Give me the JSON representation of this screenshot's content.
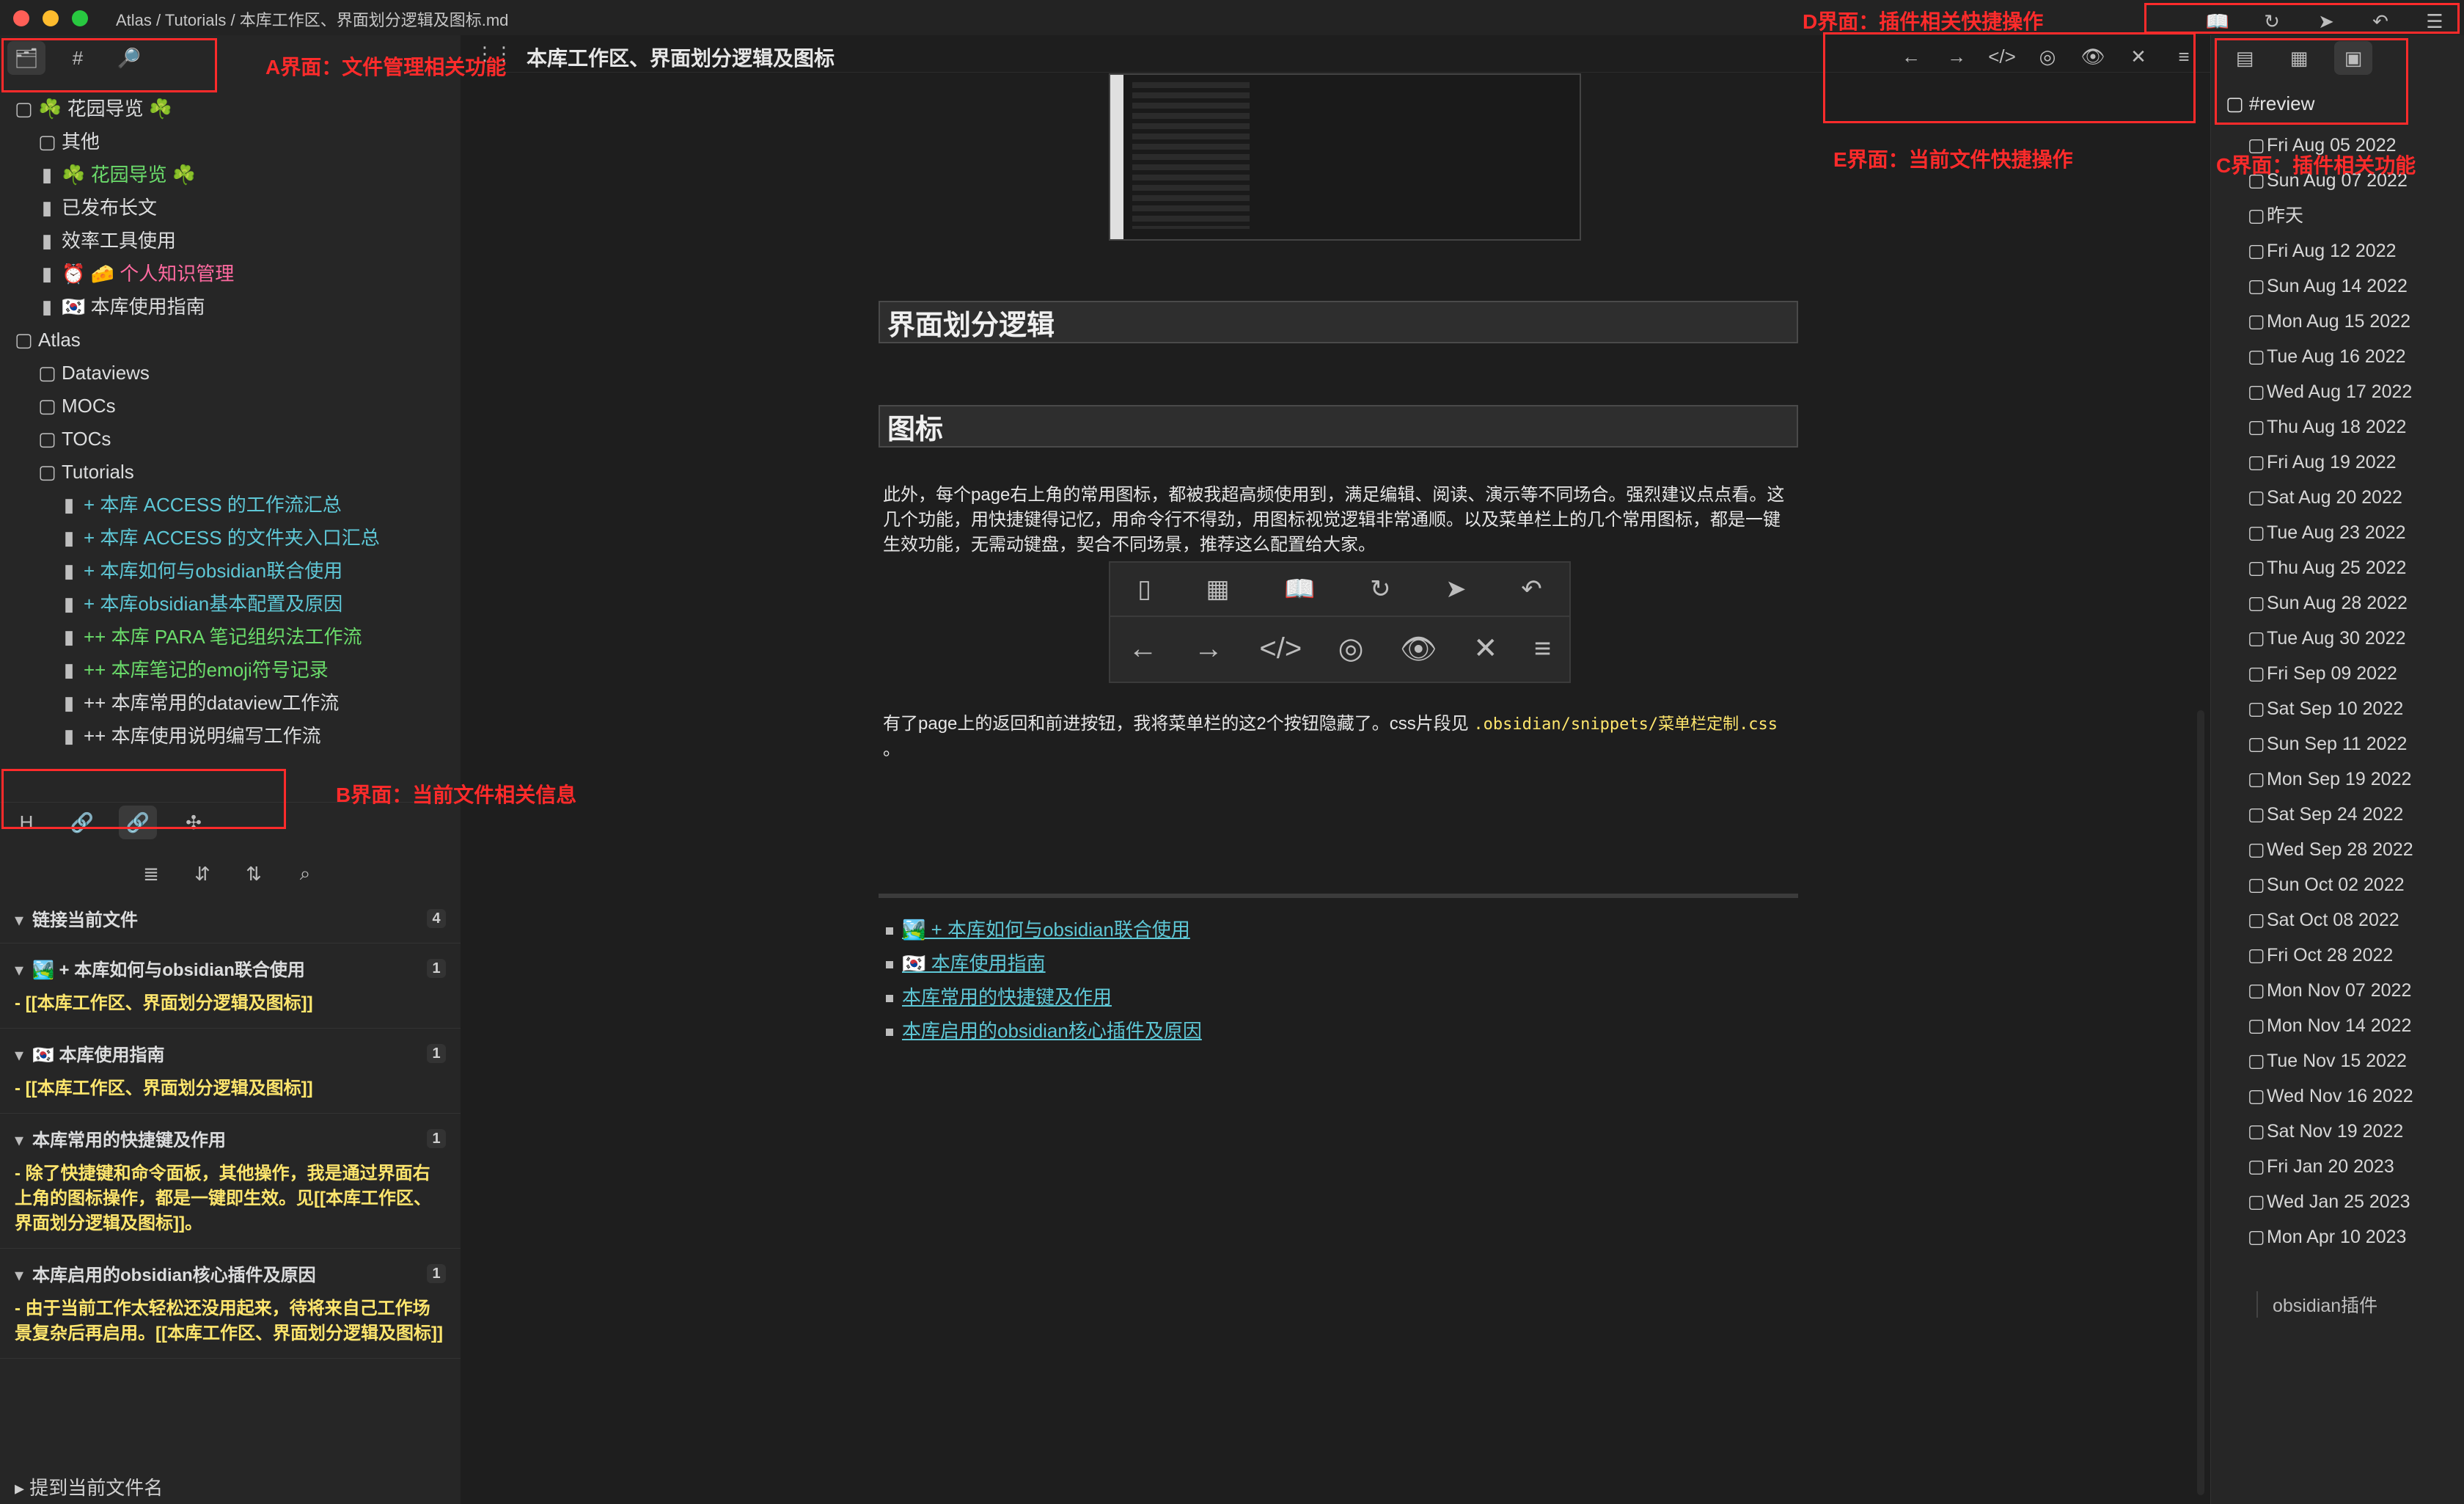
{
  "breadcrumb": "Atlas / Tutorials / 本库工作区、界面划分逻辑及图标.md",
  "annotations": {
    "A": "A界面：文件管理相关功能",
    "B": "B界面：当前文件相关信息",
    "C": "C界面：插件相关功能",
    "D": "D界面：插件相关快捷操作",
    "E": "E界面：当前文件快捷操作"
  },
  "left": {
    "tree": [
      {
        "level": 0,
        "icon": "folder-open-icon",
        "text": "☘️ 花园导览 ☘️"
      },
      {
        "level": 1,
        "icon": "folder-icon",
        "text": "其他"
      },
      {
        "level": 1,
        "icon": "doc-icon",
        "text": "☘️ 花园导览 ☘️",
        "cls": "green"
      },
      {
        "level": 1,
        "icon": "doc-icon",
        "text": "已发布长文"
      },
      {
        "level": 1,
        "icon": "doc-icon",
        "text": "效率工具使用"
      },
      {
        "level": 1,
        "icon": "doc-icon",
        "text": "⏰ 🧀 个人知识管理",
        "cls": "pink"
      },
      {
        "level": 1,
        "icon": "doc-icon",
        "text": "🇰🇷 本库使用指南"
      },
      {
        "level": 0,
        "icon": "folder-open-icon",
        "text": "Atlas"
      },
      {
        "level": 1,
        "icon": "folder-icon",
        "text": "Dataviews"
      },
      {
        "level": 1,
        "icon": "folder-icon",
        "text": "MOCs"
      },
      {
        "level": 1,
        "icon": "folder-icon",
        "text": "TOCs"
      },
      {
        "level": 1,
        "icon": "folder-open-icon",
        "text": "Tutorials"
      },
      {
        "level": 2,
        "icon": "doc-icon",
        "text": "+ 本库 ACCESS 的工作流汇总",
        "cls": "cyan"
      },
      {
        "level": 2,
        "icon": "doc-icon",
        "text": "+ 本库 ACCESS 的文件夹入口汇总",
        "cls": "cyan"
      },
      {
        "level": 2,
        "icon": "doc-icon",
        "text": "+ 本库如何与obsidian联合使用",
        "cls": "cyan"
      },
      {
        "level": 2,
        "icon": "doc-icon",
        "text": "+ 本库obsidian基本配置及原因",
        "cls": "cyan"
      },
      {
        "level": 2,
        "icon": "doc-icon",
        "text": "++ 本库 PARA 笔记组织法工作流",
        "cls": "green"
      },
      {
        "level": 2,
        "icon": "doc-icon",
        "text": "++ 本库笔记的emoji符号记录",
        "cls": "green"
      },
      {
        "level": 2,
        "icon": "doc-icon",
        "text": "++ 本库常用的dataview工作流"
      },
      {
        "level": 2,
        "icon": "doc-icon",
        "text": "++ 本库使用说明编写工作流"
      }
    ],
    "backlinks": {
      "sections": [
        {
          "title": "链接当前文件",
          "count": "4"
        },
        {
          "title": "🏞️ + 本库如何与obsidian联合使用",
          "count": "1",
          "snippet": "- [[本库工作区、界面划分逻辑及图标]]"
        },
        {
          "title": "🇰🇷 本库使用指南",
          "count": "1",
          "snippet": "- [[本库工作区、界面划分逻辑及图标]]"
        },
        {
          "title": "本库常用的快捷键及作用",
          "count": "1",
          "snippet": "- 除了快捷键和命令面板，其他操作，我是通过界面右上角的图标操作，都是一键即生效。见[[本库工作区、界面划分逻辑及图标]]。"
        },
        {
          "title": "本库启用的obsidian核心插件及原因",
          "count": "1",
          "snippet": "- 由于当前工作太轻松还没用起来，待将来自己工作场景复杂后再启用。[[本库工作区、界面划分逻辑及图标]]"
        }
      ],
      "bottom": "提到当前文件名"
    }
  },
  "main": {
    "title": "本库工作区、界面划分逻辑及图标",
    "h2a": "界面划分逻辑",
    "h2b": "图标",
    "para1": "此外，每个page右上角的常用图标，都被我超高频使用到，满足编辑、阅读、演示等不同场合。强烈建议点点看。这几个功能，用快捷键得记忆，用命令行不得劲，用图标视觉逻辑非常通顺。以及菜单栏上的几个常用图标，都是一键生效功能，无需动键盘，契合不同场景，推荐这么配置给大家。",
    "para2": "有了page上的返回和前进按钮，我将菜单栏的这2个按钮隐藏了。css片段见 ",
    "code": ".obsidian/snippets/菜单栏定制.css",
    "para2_end": "。",
    "links": [
      "🏞️ + 本库如何与obsidian联合使用",
      "🇰🇷 本库使用指南",
      "本库常用的快捷键及作用",
      "本库启用的obsidian核心插件及原因"
    ]
  },
  "right": {
    "title": "#review",
    "dates": [
      "Fri Aug 05 2022",
      "Sun Aug 07 2022",
      "昨天",
      "Fri Aug 12 2022",
      "Sun Aug 14 2022",
      "Mon Aug 15 2022",
      "Tue Aug 16 2022",
      "Wed Aug 17 2022",
      "Thu Aug 18 2022",
      "Fri Aug 19 2022",
      "Sat Aug 20 2022",
      "Tue Aug 23 2022",
      "Thu Aug 25 2022",
      "Sun Aug 28 2022",
      "Tue Aug 30 2022",
      "Fri Sep 09 2022",
      "Sat Sep 10 2022",
      "Sun Sep 11 2022",
      "Mon Sep 19 2022",
      "Sat Sep 24 2022",
      "Wed Sep 28 2022",
      "Sun Oct 02 2022",
      "Sat Oct 08 2022",
      "Fri Oct 28 2022",
      "Mon Nov 07 2022",
      "Mon Nov 14 2022",
      "Tue Nov 15 2022",
      "Wed Nov 16 2022",
      "Sat Nov 19 2022",
      "Fri Jan 20 2023",
      "Wed Jan 25 2023",
      "Mon Apr 10 2023"
    ],
    "sub": "obsidian插件"
  }
}
